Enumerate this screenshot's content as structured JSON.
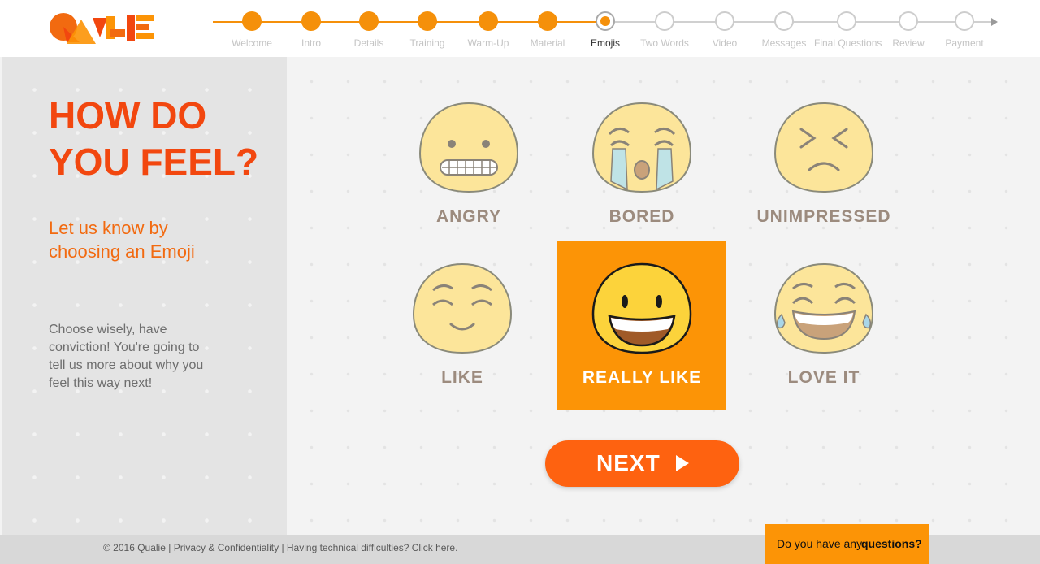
{
  "header": {
    "logo_text": "QUALIE",
    "steps": [
      {
        "label": "Welcome",
        "state": "done"
      },
      {
        "label": "Intro",
        "state": "done"
      },
      {
        "label": "Details",
        "state": "done"
      },
      {
        "label": "Training",
        "state": "done"
      },
      {
        "label": "Warm-Up",
        "state": "done"
      },
      {
        "label": "Material",
        "state": "done"
      },
      {
        "label": "Emojis",
        "state": "current"
      },
      {
        "label": "Two Words",
        "state": "todo"
      },
      {
        "label": "Video",
        "state": "todo"
      },
      {
        "label": "Messages",
        "state": "todo"
      },
      {
        "label": "Final Questions",
        "state": "todo"
      },
      {
        "label": "Review",
        "state": "todo"
      },
      {
        "label": "Payment",
        "state": "todo"
      }
    ]
  },
  "left": {
    "title_line1": "HOW DO",
    "title_line2": "YOU FEEL?",
    "subtitle": "Let us know by choosing an Emoji",
    "body": "Choose wisely, have conviction! You're going to tell us more about why you feel this way next!"
  },
  "emojis": [
    {
      "label": "ANGRY",
      "face": "grimacing-face-icon",
      "selected": false
    },
    {
      "label": "BORED",
      "face": "crying-face-icon",
      "selected": false
    },
    {
      "label": "UNIMPRESSED",
      "face": "squinting-frown-face-icon",
      "selected": false
    },
    {
      "label": "LIKE",
      "face": "content-smile-face-icon",
      "selected": false
    },
    {
      "label": "REALLY LIKE",
      "face": "big-grin-face-icon",
      "selected": true
    },
    {
      "label": "LOVE IT",
      "face": "tears-of-joy-face-icon",
      "selected": false
    }
  ],
  "next_button": {
    "label": "NEXT",
    "icon": "play-triangle-icon"
  },
  "footer": {
    "copyright": "© 2016 Qualie",
    "privacy_link": "Privacy & Confidentiality",
    "support_link": "Having technical difficulties? Click here.",
    "question_prefix": "Do you have any",
    "question_bold": "questions?"
  },
  "colors": {
    "accent_orange": "#fc9406",
    "title_red_orange": "#f2470f",
    "next_button": "#fe6210",
    "emoji_face": "#fce59a",
    "selected_face": "#fcd33b",
    "label_gray": "#9c8b7e"
  }
}
